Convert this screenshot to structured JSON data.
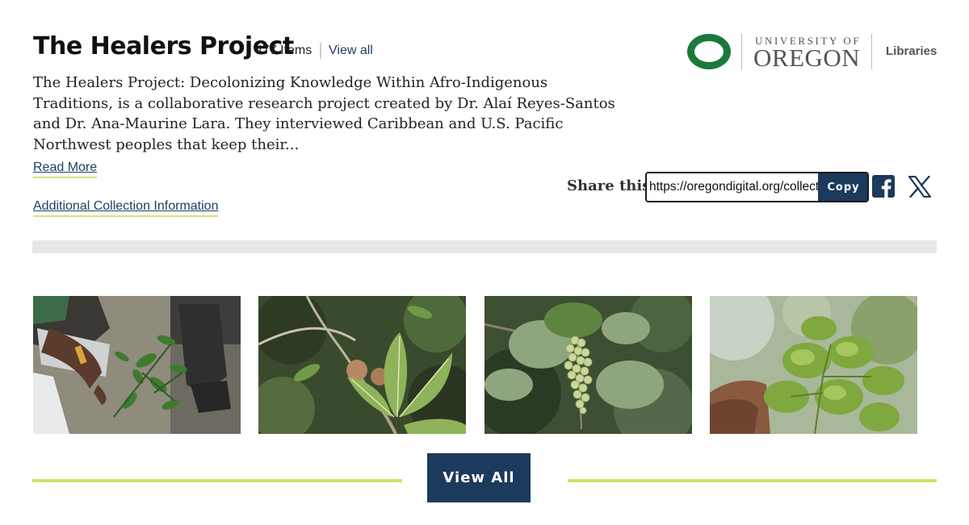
{
  "collection": {
    "title": "The Healers Project",
    "item_count": "477 Items",
    "view_all_link": "View all",
    "description": "The Healers Project: Decolonizing Knowledge Within Afro-Indigenous Traditions, is a collaborative research project created by Dr. Alaí Reyes-Santos and Dr. Ana-Maurine Lara. They interviewed Caribbean and U.S. Pacific Northwest peoples that keep their...",
    "read_more": "Read More",
    "additional_info": "Additional Collection Information"
  },
  "logo": {
    "line1": "UNIVERSITY OF",
    "line2": "OREGON",
    "libraries": "Libraries",
    "brand_color": "#1b7a3a"
  },
  "share": {
    "label": "Share this:",
    "url": "https://oregondigital.org/collections/healers",
    "copy_label": "Copy",
    "icons": [
      "facebook-icon",
      "x-icon"
    ]
  },
  "thumbnails": [
    {
      "name": "thumbnail-hand-herbs"
    },
    {
      "name": "thumbnail-plant-fruit"
    },
    {
      "name": "thumbnail-seagrape-cluster"
    },
    {
      "name": "thumbnail-hand-leaves"
    }
  ],
  "footer": {
    "view_all_button": "View All"
  },
  "colors": {
    "navy": "#1b3a5c",
    "link": "#1f3e63",
    "accent_line": "#d4df6a"
  }
}
